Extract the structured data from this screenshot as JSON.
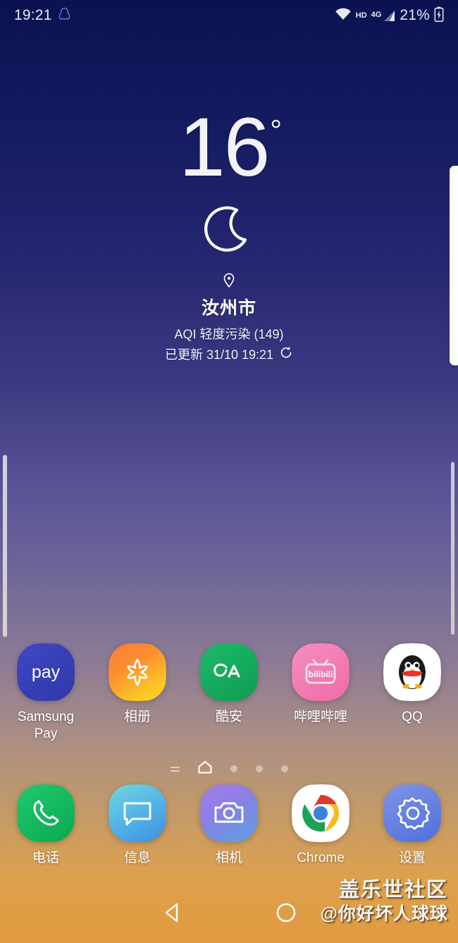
{
  "status_bar": {
    "clock": "19:21",
    "notification_icon": "qq-penguin-icon",
    "wifi_icon": "wifi-icon",
    "hd_label": "HD",
    "network_label": "4G",
    "signal_icon": "signal-bars-icon",
    "battery_percent": "21%",
    "battery_icon": "battery-charging-icon"
  },
  "weather": {
    "temperature": "16",
    "degree_symbol": "°",
    "condition_icon": "crescent-moon-icon",
    "location_icon": "location-pin-icon",
    "city": "汝州市",
    "aqi": "AQI 轻度污染 (149)",
    "updated": "已更新 31/10 19:21",
    "refresh_icon": "refresh-icon"
  },
  "apps": {
    "row1": [
      {
        "label": "Samsung\nPay",
        "icon": "samsung-pay-icon",
        "color": "#3a43b5"
      },
      {
        "label": "相册",
        "icon": "gallery-icon",
        "color": "#f7a020"
      },
      {
        "label": "酷安",
        "icon": "coolapk-icon",
        "color": "#15a85c"
      },
      {
        "label": "哔哩哔哩",
        "icon": "bilibili-icon",
        "color": "#f070a8"
      },
      {
        "label": "QQ",
        "icon": "qq-icon",
        "color": "#ffffff"
      }
    ],
    "row2": [
      {
        "label": "电话",
        "icon": "phone-icon",
        "color": "#10b85e"
      },
      {
        "label": "信息",
        "icon": "messages-icon",
        "color": "#49a9e8"
      },
      {
        "label": "相机",
        "icon": "camera-icon",
        "color": "#8f7de0"
      },
      {
        "label": "Chrome",
        "icon": "chrome-icon",
        "color": "#ffffff"
      },
      {
        "label": "设置",
        "icon": "settings-gear-icon",
        "color": "#5e7ae0"
      }
    ]
  },
  "page_indicator": {
    "bixby_icon": "bixby-home-icon",
    "home_icon": "home-page-icon",
    "dots": 3,
    "active_page": "home"
  },
  "nav_bar": {
    "back_icon": "back-triangle-icon",
    "home_icon": "home-circle-icon",
    "recents_icon": "recents-icon"
  },
  "watermark": {
    "line1": "盖乐世社区",
    "line2": "@你好坏人球球"
  },
  "edge_panel": {
    "handle_icon": "edge-panel-handle"
  },
  "colors": {
    "bg_top": "#0b1252",
    "bg_mid": "#6c6499",
    "bg_bottom": "#e29a3f",
    "text_primary": "#ffffff"
  }
}
